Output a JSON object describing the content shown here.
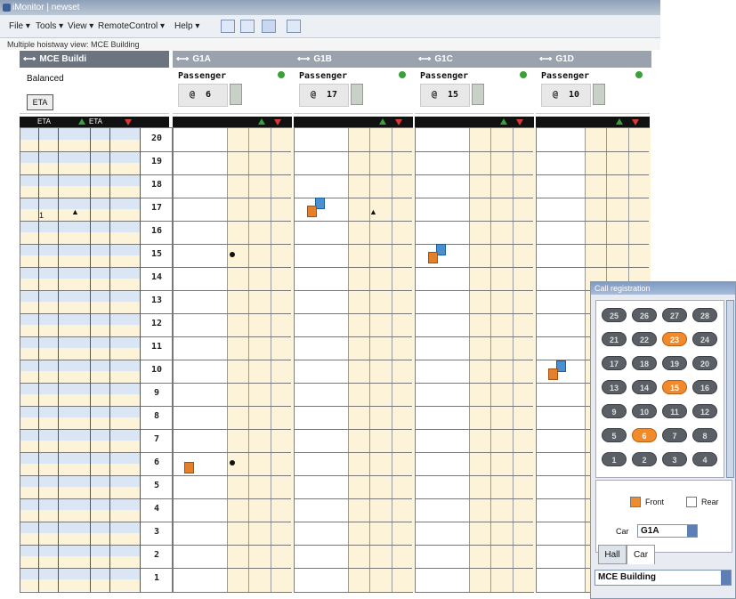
{
  "window": {
    "title": "iMonitor | newset"
  },
  "menu": {
    "file": "File",
    "tools": "Tools",
    "view": "View",
    "remote": "RemoteControl",
    "help": "Help"
  },
  "view_label": "Multiple hoistway view: MCE Building",
  "building": {
    "header": "MCE Buildi",
    "mode": "Balanced",
    "eta_button": "ETA",
    "eta_up": "ETA",
    "eta_down": "ETA",
    "eta_value_17": "1"
  },
  "cars": [
    {
      "name": "G1A",
      "type": "Passenger",
      "position": "6"
    },
    {
      "name": "G1B",
      "type": "Passenger",
      "position": "17"
    },
    {
      "name": "G1C",
      "type": "Passenger",
      "position": "15"
    },
    {
      "name": "G1D",
      "type": "Passenger",
      "position": "10"
    }
  ],
  "floors": [
    "20",
    "19",
    "18",
    "17",
    "16",
    "15",
    "14",
    "13",
    "12",
    "11",
    "10",
    "9",
    "8",
    "7",
    "6",
    "5",
    "4",
    "3",
    "2",
    "1"
  ],
  "call_registration": {
    "title": "Call registration",
    "rows": [
      [
        "25",
        "26",
        "27",
        "28"
      ],
      [
        "21",
        "22",
        "23",
        "24"
      ],
      [
        "17",
        "18",
        "19",
        "20"
      ],
      [
        "13",
        "14",
        "15",
        "16"
      ],
      [
        "9",
        "10",
        "11",
        "12"
      ],
      [
        "5",
        "6",
        "7",
        "8"
      ],
      [
        "1",
        "2",
        "3",
        "4"
      ]
    ],
    "active": [
      "23",
      "15",
      "6"
    ],
    "front_label": "Front",
    "rear_label": "Rear",
    "car_label": "Car",
    "car_value": "G1A",
    "tab_hall": "Hall",
    "tab_car": "Car",
    "building_value": "MCE Building"
  },
  "colors": {
    "accent_orange": "#f08a2a",
    "stripe_yellow": "#fdf3d8",
    "stripe_blue": "#dbe6f5",
    "header_gray": "#9aa2ae"
  }
}
